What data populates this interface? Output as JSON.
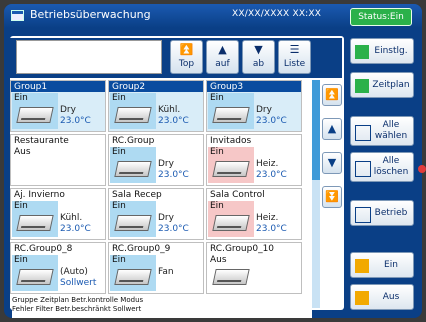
{
  "title_bar": {
    "title": "Betriebsüberwachung",
    "datetime": "XX/XX/XXXX  XX:XX",
    "status_button": "Status:Ein"
  },
  "nav": {
    "top": "Top",
    "up": "auf",
    "down": "ab",
    "list": "Liste"
  },
  "groups": [
    {
      "name": "Group1",
      "state": "Ein",
      "mode": "Dry",
      "temp": "23.0°C",
      "selected": true
    },
    {
      "name": "Group2",
      "state": "Ein",
      "mode": "Kühl.",
      "temp": "23.0°C",
      "selected": true
    },
    {
      "name": "Group3",
      "state": "Ein",
      "mode": "Dry",
      "temp": "23.0°C",
      "selected": true
    },
    {
      "name": "Restaurante",
      "state": "Aus",
      "mode": "",
      "temp": ""
    },
    {
      "name": "RC.Group",
      "state": "Ein",
      "mode": "Dry",
      "temp": "23.0°C"
    },
    {
      "name": "Invitados",
      "state": "Ein",
      "mode": "Heiz.",
      "temp": "23.0°C",
      "heat": true
    },
    {
      "name": "Aj. Invierno",
      "state": "Ein",
      "mode": "Kühl.",
      "temp": "23.0°C"
    },
    {
      "name": "Sala Recep",
      "state": "Ein",
      "mode": "Dry",
      "temp": "23.0°C"
    },
    {
      "name": "Sala Control",
      "state": "Ein",
      "mode": "Heiz.",
      "temp": "23.0°C",
      "heat": true
    },
    {
      "name": "RC.Group0_8",
      "state": "Ein",
      "mode": "(Auto)",
      "temp": "Sollwert"
    },
    {
      "name": "RC.Group0_9",
      "state": "Ein",
      "mode": "Fan",
      "temp": ""
    },
    {
      "name": "RC.Group0_10",
      "state": "Aus",
      "mode": "",
      "temp": ""
    }
  ],
  "legend": {
    "line1": "Gruppe  Zeitplan  Betr.kontrolle  Modus",
    "line2": "Fehler  Filter  Betr.beschränkt  Sollwert"
  },
  "side": {
    "einstlg": "Einstlg.",
    "zeitplan": "Zeitplan",
    "alle_waehlen": "Alle wählen",
    "alle_loeschen": "Alle löschen",
    "betrieb": "Betrieb",
    "ein": "Ein",
    "aus": "Aus"
  }
}
